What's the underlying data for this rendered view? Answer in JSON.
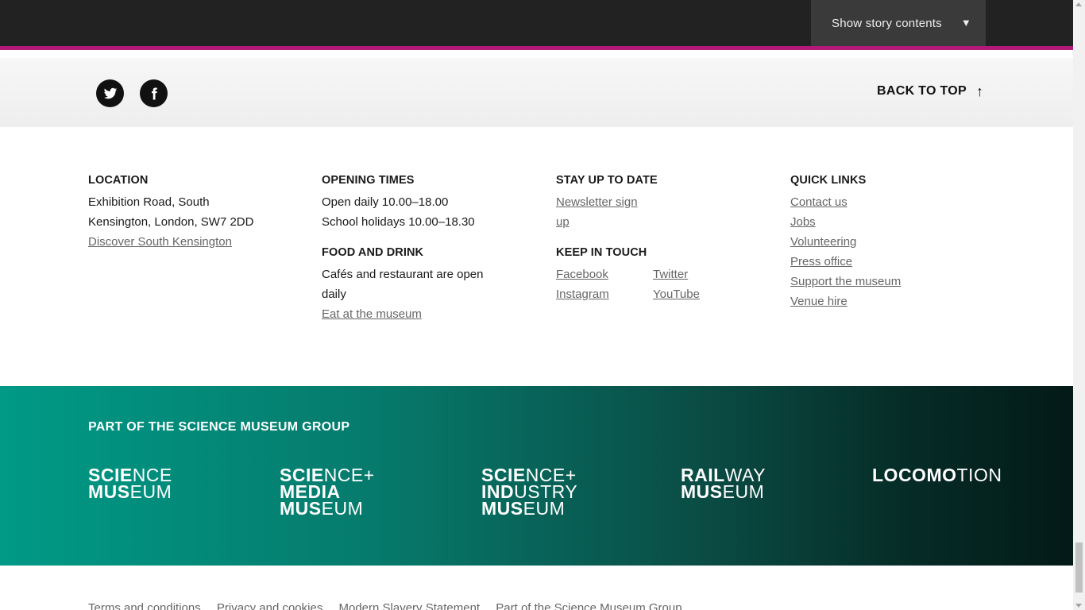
{
  "topbar": {
    "story_button_label": "Show story contents",
    "caret_icon": "▼"
  },
  "social": {
    "icons": [
      "twitter-icon",
      "facebook-icon"
    ],
    "back_to_top_label": "BACK TO TOP",
    "back_to_top_arrow": "↑"
  },
  "footer": {
    "location": {
      "heading": "LOCATION",
      "address_line1": "Exhibition Road, South",
      "address_line2": "Kensington, London, SW7 2DD",
      "link": "Discover South Kensington"
    },
    "opening_times": {
      "heading": "OPENING TIMES",
      "line1": "Open daily 10.00–18.00",
      "line2": "School holidays 10.00–18.30"
    },
    "food_and_drink": {
      "heading": "FOOD AND DRINK",
      "line1": "Cafés and restaurant are open",
      "line2": "daily",
      "link": "Eat at the museum"
    },
    "stay_up_to_date": {
      "heading": "STAY UP TO DATE",
      "link_line1": "Newsletter sign",
      "link_line2": "up"
    },
    "keep_in_touch": {
      "heading": "KEEP IN TOUCH",
      "links": [
        "Facebook",
        "Twitter",
        "Instagram",
        "YouTube"
      ]
    },
    "quick_links": {
      "heading": "QUICK LINKS",
      "links": [
        "Contact us",
        "Jobs",
        "Volunteering",
        "Press office",
        "Support the museum",
        "Venue hire"
      ]
    }
  },
  "group": {
    "heading": "PART OF THE SCIENCE MUSEUM GROUP",
    "logos": {
      "science_museum": {
        "a1": "SCIE",
        "a2": "NCE",
        "b1": "MUS",
        "b2": "EUM"
      },
      "media_museum": {
        "a1": "SCIE",
        "a2": "NCE+",
        "b1": "MEDIA",
        "c1": "MUS",
        "c2": "EUM"
      },
      "industry_museum": {
        "a1": "SCIE",
        "a2": "NCE+",
        "b1": "IND",
        "b2": "USTRY",
        "c1": "MUS",
        "c2": "EUM"
      },
      "railway_museum": {
        "a1": "RAIL",
        "a2": "WAY",
        "b1": "MUS",
        "b2": "EUM"
      },
      "locomotion": {
        "a1": "LOCOMO",
        "a2": "TION"
      }
    }
  },
  "bottom_links": [
    "Terms and conditions",
    "Privacy and cookies",
    "Modern Slavery Statement",
    "Part of the Science Museum Group"
  ],
  "colors": {
    "accent": "#b4187a",
    "topbar": "#222222",
    "group_band_start": "#009a86",
    "group_band_end": "#031a17"
  }
}
